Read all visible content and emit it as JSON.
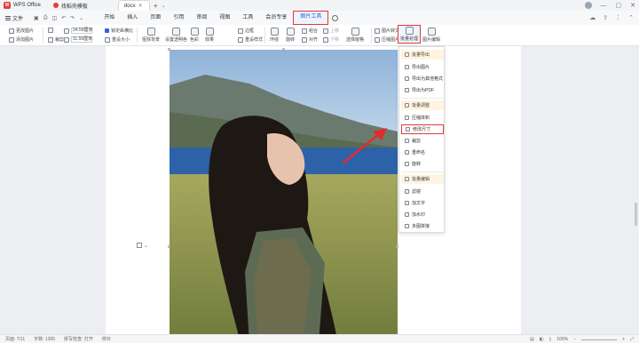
{
  "titlebar": {
    "app_name": "WPS Office",
    "doc_tab_1": "找稻壳模板",
    "doc_tab_2": "docx"
  },
  "menubar": {
    "file_label": "文件",
    "tabs": [
      "开始",
      "插入",
      "页面",
      "引用",
      "审阅",
      "视图",
      "工具",
      "会员专享",
      "图片工具"
    ],
    "active_tab_index": 8
  },
  "ribbon": {
    "change_image": "更改图片",
    "add_image": "添加图片",
    "crop": "裁剪",
    "width_value": "24.59厘米",
    "height_value": "11.55厘米",
    "lock_ratio": "锁定纵横比",
    "reset_size": "重设大小",
    "remove_bg": "抠除背景",
    "set_transparent": "设置透明色",
    "color": "色彩",
    "effects": "效果",
    "border": "边框",
    "reset_style": "重设样式",
    "wrap": "环绕",
    "rotate": "旋转",
    "combine": "组合",
    "align": "对齐",
    "move_up": "上移",
    "move_down": "下移",
    "selection_pane": "选择窗格",
    "image_to_text": "图片转文字",
    "compress": "压缩图片",
    "batch_process": "批量处理",
    "image_edit": "图片编辑"
  },
  "dropdown": {
    "section_export": "批量导出",
    "export_images": "导出图片",
    "export_other_format": "导出为其他格式",
    "export_pdf": "导出为PDF",
    "section_adjust": "批量调整",
    "compress_volume": "压缩体积",
    "resize": "修改尺寸",
    "crop": "裁剪",
    "rename": "重命名",
    "rotate": "旋转",
    "section_edit": "批量编辑",
    "filter": "滤镜",
    "add_text": "加文字",
    "add_watermark": "加水印",
    "multi_format": "多图拼接"
  },
  "statusbar": {
    "page": "页面: 7/11",
    "words": "字数: 1305",
    "spell": "拼写检查: 打开",
    "proof": "校对",
    "zoom": "100%"
  },
  "colors": {
    "accent_blue": "#2f63d8",
    "highlight_red": "#e03a3a",
    "arrow_red": "#e32b2b"
  }
}
